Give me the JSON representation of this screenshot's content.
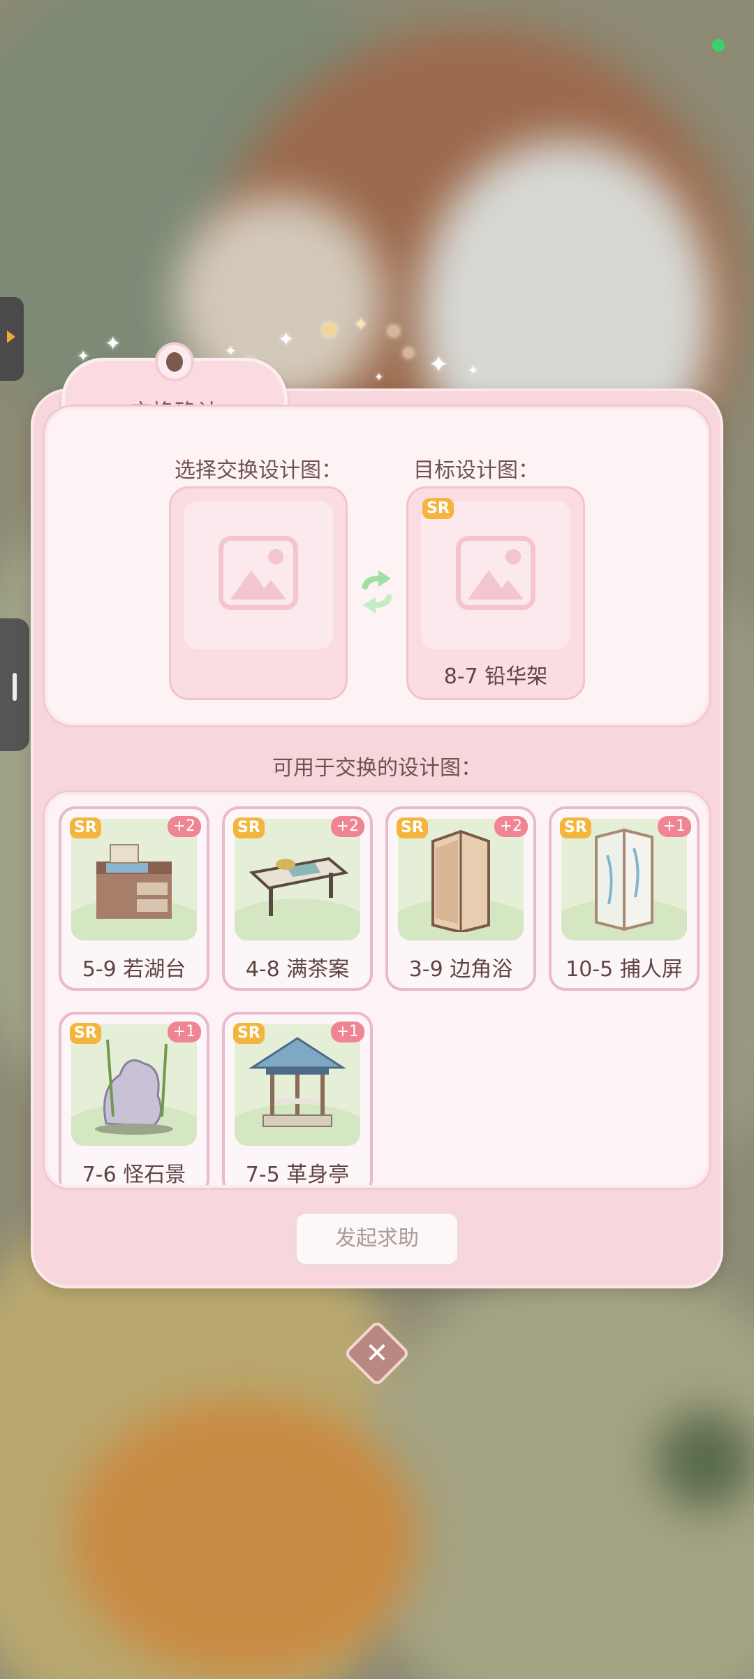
{
  "dialog": {
    "title": "交换确认",
    "select_label": "选择交换设计图：",
    "target_label": "目标设计图：",
    "target": {
      "rarity": "SR",
      "name": "8-7 铅华架"
    },
    "available_label": "可用于交换的设计图：",
    "items": [
      {
        "rarity": "SR",
        "count": "+2",
        "name": "5-9 若湖台",
        "icon": "sink-cabinet-icon"
      },
      {
        "rarity": "SR",
        "count": "+2",
        "name": "4-8 满茶案",
        "icon": "tea-table-icon"
      },
      {
        "rarity": "SR",
        "count": "+2",
        "name": "3-9 边角浴",
        "icon": "shower-room-icon"
      },
      {
        "rarity": "SR",
        "count": "+1",
        "name": "10-5 捕人屏",
        "icon": "folding-screen-icon"
      },
      {
        "rarity": "SR",
        "count": "+1",
        "name": "7-6 怪石景",
        "icon": "rock-bamboo-icon"
      },
      {
        "rarity": "SR",
        "count": "+1",
        "name": "7-5 革身亭",
        "icon": "pavilion-icon"
      }
    ],
    "help_button": "发起求助"
  },
  "colors": {
    "panel_pink": "#f7d6dc",
    "sr_badge": "#f3b53d",
    "count_badge": "#ef8593",
    "swap_arrows": "#9fe0a8"
  },
  "icons": {
    "close": "close-icon",
    "swap": "swap-arrows-icon",
    "placeholder": "image-placeholder-icon"
  }
}
